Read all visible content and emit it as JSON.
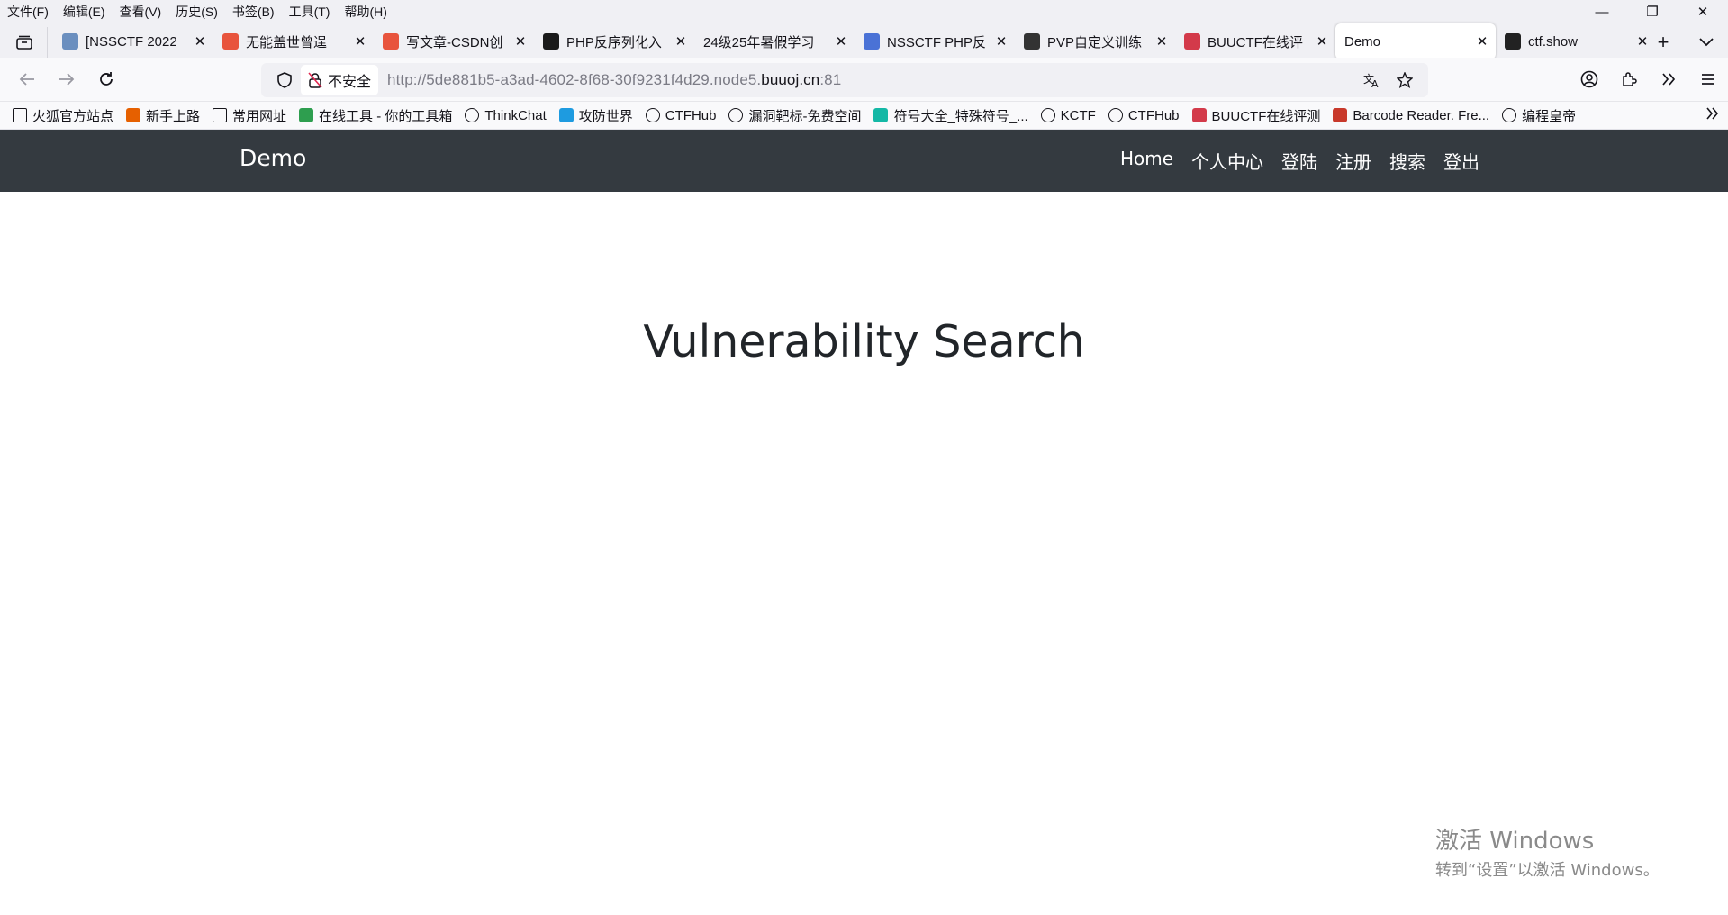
{
  "menubar": {
    "items": [
      "文件(F)",
      "编辑(E)",
      "查看(V)",
      "历史(S)",
      "书签(B)",
      "工具(T)",
      "帮助(H)"
    ]
  },
  "window_controls": {
    "minimize": "—",
    "restore": "❐",
    "close": "✕"
  },
  "tabs": [
    {
      "title": "[NSSCTF 2022",
      "icon": "nssctf-icon",
      "color": "#6b8fbf"
    },
    {
      "title": "无能盖世曾逞",
      "icon": "csdn-icon",
      "color": "#e8543d"
    },
    {
      "title": "写文章-CSDN创",
      "icon": "csdn-icon",
      "color": "#e8543d"
    },
    {
      "title": "PHP反序列化入",
      "icon": "k-icon",
      "color": "#1a1a1a"
    },
    {
      "title": "24级25年暑假学习",
      "icon": "",
      "color": ""
    },
    {
      "title": "NSSCTF PHP反",
      "icon": "nssctf-icon",
      "color": "#4a72d6"
    },
    {
      "title": "PVP自定义训练",
      "icon": "flag-icon",
      "color": "#333333"
    },
    {
      "title": "BUUCTF在线评",
      "icon": "buuctf-icon",
      "color": "#d33a4a"
    },
    {
      "title": "Demo",
      "icon": "",
      "color": "",
      "active": true
    },
    {
      "title": "ctf.show",
      "icon": "ctfshow-icon",
      "color": "#222222"
    }
  ],
  "tab_actions": {
    "new_tab": "+",
    "list_all": "⌄"
  },
  "urlbar": {
    "security_label": "不安全",
    "url_prefix": "http://5de881b5-a3ad-4602-8f68-30f9231f4d29.node5.",
    "url_domain": "buuoj.cn",
    "url_suffix": ":81"
  },
  "bookmarks": [
    {
      "label": "火狐官方站点",
      "icon": "folder-icon",
      "color": ""
    },
    {
      "label": "新手上路",
      "icon": "firefox-icon",
      "color": "#e66000"
    },
    {
      "label": "常用网址",
      "icon": "folder-icon",
      "color": ""
    },
    {
      "label": "在线工具 - 你的工具箱",
      "icon": "tool-icon",
      "color": "#2e9e4f"
    },
    {
      "label": "ThinkChat",
      "icon": "globe-icon",
      "color": ""
    },
    {
      "label": "攻防世界",
      "icon": "adworld-icon",
      "color": "#1e9be0"
    },
    {
      "label": "CTFHub",
      "icon": "ctfhub-icon",
      "color": ""
    },
    {
      "label": "漏洞靶标-免费空间",
      "icon": "target-icon",
      "color": ""
    },
    {
      "label": "符号大全_特殊符号_...",
      "icon": "ke-icon",
      "color": "#14b8a6"
    },
    {
      "label": "KCTF",
      "icon": "snowflake-icon",
      "color": ""
    },
    {
      "label": "CTFHub",
      "icon": "ctfhub-icon",
      "color": ""
    },
    {
      "label": "BUUCTF在线评测",
      "icon": "buuctf-icon",
      "color": "#d33a4a"
    },
    {
      "label": "Barcode Reader. Fre...",
      "icon": "barcode-icon",
      "color": "#c8392b"
    },
    {
      "label": "编程皇帝",
      "icon": "globe-icon",
      "color": ""
    }
  ],
  "site": {
    "brand": "Demo",
    "nav": [
      "Home",
      "个人中心",
      "登陆",
      "注册",
      "搜索",
      "登出"
    ],
    "heading": "Vulnerability Search"
  },
  "watermark": {
    "line1": "激活 Windows",
    "line2": "转到“设置”以激活 Windows。"
  }
}
